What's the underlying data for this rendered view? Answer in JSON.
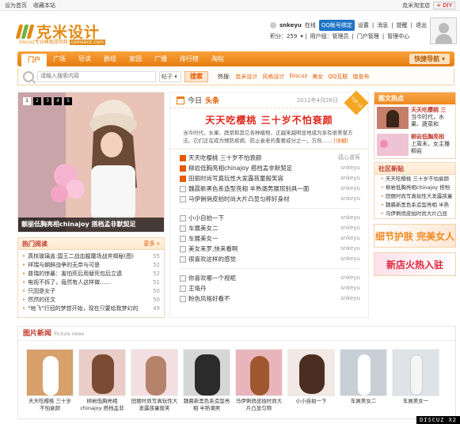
{
  "topbar": {
    "set_home": "设为首页",
    "bookmark": "收藏本站",
    "theme": "克米淘宝店",
    "diy": "DIY"
  },
  "brand": {
    "name": "克米设计",
    "slogan": "Discuz专业模板提供商",
    "url": "comsenz.com"
  },
  "user": {
    "name": "snkeyu",
    "status": "在线",
    "qq_bind": "QQ帐号绑定",
    "links": [
      "设置",
      "消息",
      "提醒",
      "退出"
    ],
    "points": "积分：259",
    "groups": [
      "用户组：管理员",
      "门户管理",
      "管理中心"
    ]
  },
  "nav": {
    "items": [
      "门户",
      "广场",
      "导读",
      "群组",
      "家园",
      "广播",
      "排行榜",
      "淘帖"
    ],
    "quick": "快捷导航"
  },
  "search": {
    "placeholder": "请输入搜索内容",
    "scope": "帖子",
    "button": "搜索",
    "hot_label": "热搜:",
    "hot_terms": [
      "克米设计",
      "风格设计",
      "Discuz",
      "美女",
      "QQ互联",
      "值宣布"
    ]
  },
  "slide": {
    "dots": [
      "1",
      "2",
      "3",
      "4",
      "5"
    ],
    "caption": "靓丽低胸亮相chinajoy 搭档孟非默契足"
  },
  "hot_reading": {
    "title": "热门阅读",
    "more": "更多",
    "items": [
      {
        "t": "真核玻璃盖:国王二战血腥屠场战斧揭秘(图)",
        "n": "55"
      },
      {
        "t": "祥瑞与朝鲜战争的无奈与可是",
        "n": "52"
      },
      {
        "t": "普瑞的惊暴：害怕死后用替死包后立遗",
        "n": "52"
      },
      {
        "t": "电视不拆了，竟然有人这样做……",
        "n": "51"
      },
      {
        "t": "只因是女子",
        "n": "50"
      },
      {
        "t": "然然的往文",
        "n": "50"
      },
      {
        "t": "\"地飞\"行冠的梦想开始，现在只要给我梦幻的",
        "n": "49"
      }
    ]
  },
  "center": {
    "today": "今日",
    "today_hl": "头条",
    "date": "2012年4月26日",
    "badge": "TOP 10",
    "headline": "天天吃樱桃 三十岁不怕衰颜",
    "summary": "当今时代，水果、蔬菜和其它各种植物，正越来越明显地成为享有很美誉方法。它们正在成为预防疾病、防止衰老的重要成分之一，方剂……",
    "detail": "[详细]",
    "group1": [
      {
        "t": "天天吃樱桃 三十岁不怕衰颜",
        "a": "孤心谱客",
        "red": true
      },
      {
        "t": "柳岩低胸亮相chinajoy 搭档孟非默契足",
        "a": "snkeyu",
        "red": true
      },
      {
        "t": "田丽时尚写真玩性大发露孩童般笑容",
        "a": "snkeyu",
        "red": true
      },
      {
        "t": "魏晨新黑色系造型亮相 半熟潮男展现别具一面",
        "a": "snkeyu",
        "red": false
      },
      {
        "t": "马伊俐俏皮拍时尚大片凸显匀称好身材",
        "a": "snkeyu",
        "red": false
      }
    ],
    "group2": [
      {
        "t": "小小自拍一下",
        "a": "snkeyu"
      },
      {
        "t": "车展美女二",
        "a": "snkeyu"
      },
      {
        "t": "车展美女一",
        "a": "snkeyu"
      },
      {
        "t": "美女来罗,快来看啊",
        "a": "snkeyu"
      },
      {
        "t": "很喜欢这样的感觉",
        "a": "snkeyu"
      }
    ],
    "group3": [
      {
        "t": "你喜欢哪一个视呢",
        "a": "snkeyu"
      },
      {
        "t": "王珞丹",
        "a": "snkeyu"
      },
      {
        "t": "粉色风格好看不",
        "a": "snkeyu"
      }
    ]
  },
  "right": {
    "pic_title": "图文热点",
    "pics": [
      {
        "b": "天天吃樱桃 三",
        "t": "当今时代，水果、蔬菜和"
      },
      {
        "b": "柳岩低胸亮相",
        "t": "上周末，女主播柳岩"
      }
    ],
    "community_title": "社区新贴",
    "community": [
      "天天吃樱桃 三十岁不怕衰颜",
      "柳岩低胸亮相chinajoy 搭档",
      "田丽时尚写真玩性大发露孩童",
      "魏晨新黑色系造型亮相 半熟",
      "马伊俐俏皮拍时尚大片凸显"
    ],
    "ad1": "细节护肤 完美女人",
    "ad2": "新店火热入驻"
  },
  "picture_news": {
    "title": "图片新闻",
    "subtitle": "Picture news",
    "items": [
      "天天吃樱桃 三十岁不怕衰颜",
      "柳岩低胸亮相chinajoy 搭档孟非",
      "田丽时尚写真玩性大发露孩童般笑",
      "魏晨新黑色系造型亮相 半熟潮男",
      "马伊俐俏皮拍时尚大片凸显匀称",
      "小小自拍一下",
      "车展美女二",
      "车展美女一"
    ]
  },
  "watermark": "DISCUZ X2"
}
